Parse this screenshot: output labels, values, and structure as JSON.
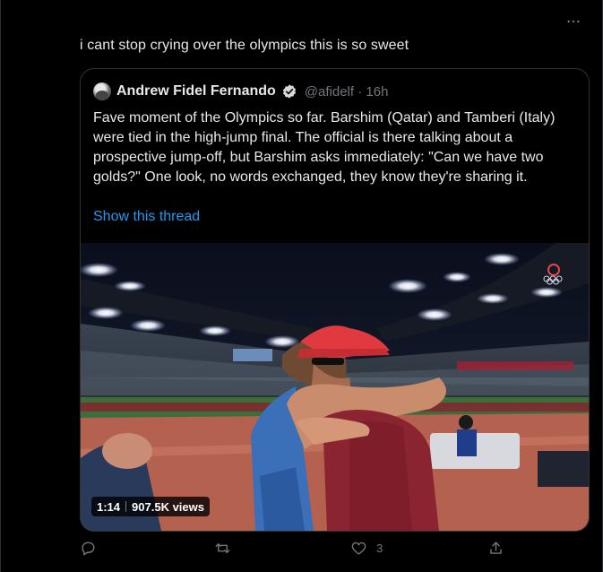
{
  "tweet": {
    "text": "i cant stop crying over the olympics this is so sweet",
    "more_icon": "more-horizontal-icon"
  },
  "quote": {
    "author_name": "Andrew Fidel Fernando",
    "verified": true,
    "handle_time": "@afidelf · 16h",
    "body": "Fave moment of the Olympics so far. Barshim (Qatar) and Tamberi (Italy) were tied in the high-jump final. The official is there talking about a prospective jump-off, but Barshim asks immediately: \"Can we have two golds?\" One look, no words exchanged, they know they're sharing it.",
    "show_thread": "Show this thread",
    "video": {
      "duration": "1:14",
      "views": "907.5K views"
    }
  },
  "actions": {
    "reply_count": "",
    "retweet_count": "",
    "like_count": "3",
    "share_label": ""
  },
  "colors": {
    "background": "#000000",
    "border": "#2f3336",
    "link": "#1d9bf0",
    "muted": "#71767b",
    "text": "#e7e9ea"
  }
}
